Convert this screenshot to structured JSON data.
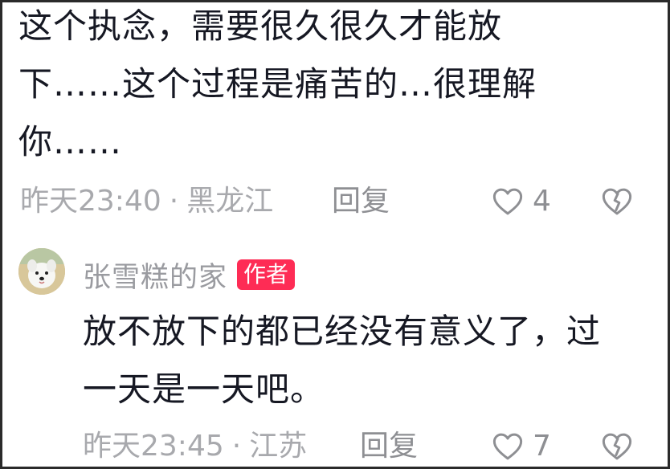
{
  "comment1": {
    "lines": [
      "这个执念，需要很久很久才能放",
      "下……这个过程是痛苦的…很理解",
      "你……"
    ],
    "time": "昨天23:40",
    "separator": "·",
    "location": "黑龙江",
    "reply_label": "回复",
    "like_count": "4"
  },
  "comment2": {
    "author": "张雪糕的家",
    "author_badge": "作者",
    "lines": [
      "放不放下的都已经没有意义了，过",
      "一天是一天吧。"
    ],
    "time": "昨天23:45",
    "separator": "·",
    "location": "江苏",
    "reply_label": "回复",
    "like_count": "7"
  },
  "colors": {
    "badge": "#fe2c55",
    "meta": "#a8a9ad",
    "text": "#161823"
  },
  "icons": {
    "like": "heart-outline-icon",
    "dislike": "broken-heart-icon"
  }
}
